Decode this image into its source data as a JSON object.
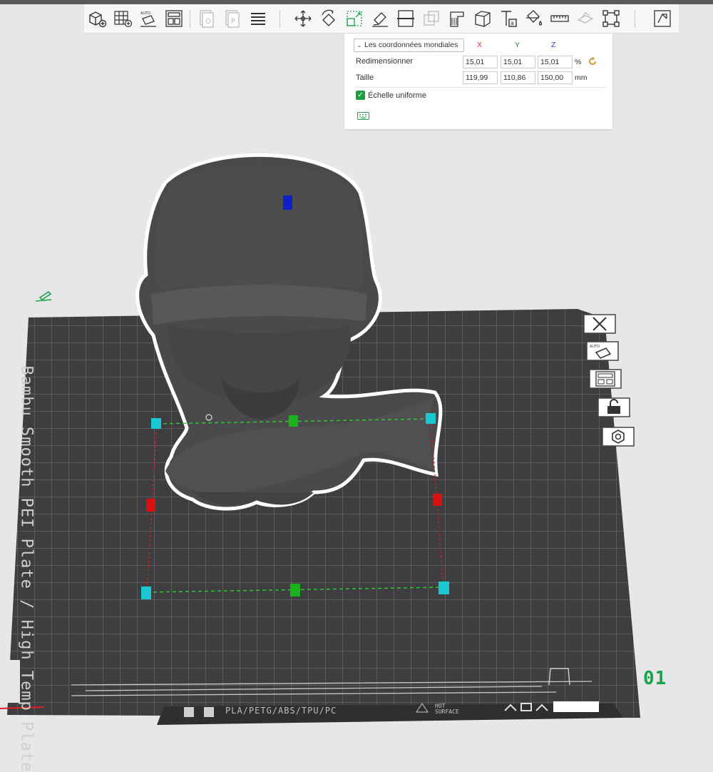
{
  "toolbar": {
    "buttons": [
      {
        "name": "add-cube-icon"
      },
      {
        "name": "add-plate-icon"
      },
      {
        "name": "auto-orient-icon"
      },
      {
        "name": "arrange-icon"
      },
      {
        "name": "split-objects-icon"
      },
      {
        "name": "split-parts-icon"
      },
      {
        "name": "layers-icon"
      },
      {
        "name": "move-icon"
      },
      {
        "name": "rotate-icon"
      },
      {
        "name": "scale-icon"
      },
      {
        "name": "lay-on-face-icon"
      },
      {
        "name": "cut-icon"
      },
      {
        "name": "mesh-boolean-icon"
      },
      {
        "name": "support-paint-icon"
      },
      {
        "name": "seam-paint-icon"
      },
      {
        "name": "text-icon"
      },
      {
        "name": "color-paint-icon"
      },
      {
        "name": "measure-icon"
      },
      {
        "name": "assembly-icon"
      },
      {
        "name": "variable-layer-icon"
      },
      {
        "name": "slice-view-icon"
      }
    ]
  },
  "scale_panel": {
    "coordinates_select": "Les coordonnées mondiales",
    "axes": [
      "X",
      "Y",
      "Z"
    ],
    "rows": [
      {
        "label": "Redimensionner",
        "values": [
          "15,01",
          "15,01",
          "15,01"
        ],
        "unit": "%"
      },
      {
        "label": "Taille",
        "values": [
          "119,99",
          "110,86",
          "150,00"
        ],
        "unit": "mm"
      }
    ],
    "uniform_scale_label": "Échelle uniforme",
    "uniform_scale_checked": true,
    "axis_colors": {
      "x": "#e03030",
      "y": "#2aa02a",
      "z": "#3050e0"
    }
  },
  "plate": {
    "label": "Bambu Smooth PEI Plate / High Temp Plate",
    "filament_types": "PLA/PETG/ABS/TPU/PC",
    "hot_surface": [
      "HOT",
      "SURFACE"
    ],
    "plate_number": "01",
    "plate_number_color": "#19a34a"
  },
  "side_buttons": [
    {
      "name": "close-plate-icon"
    },
    {
      "name": "auto-orient-plate-icon"
    },
    {
      "name": "arrange-plate-icon"
    },
    {
      "name": "lock-plate-icon"
    },
    {
      "name": "plate-settings-icon"
    }
  ]
}
